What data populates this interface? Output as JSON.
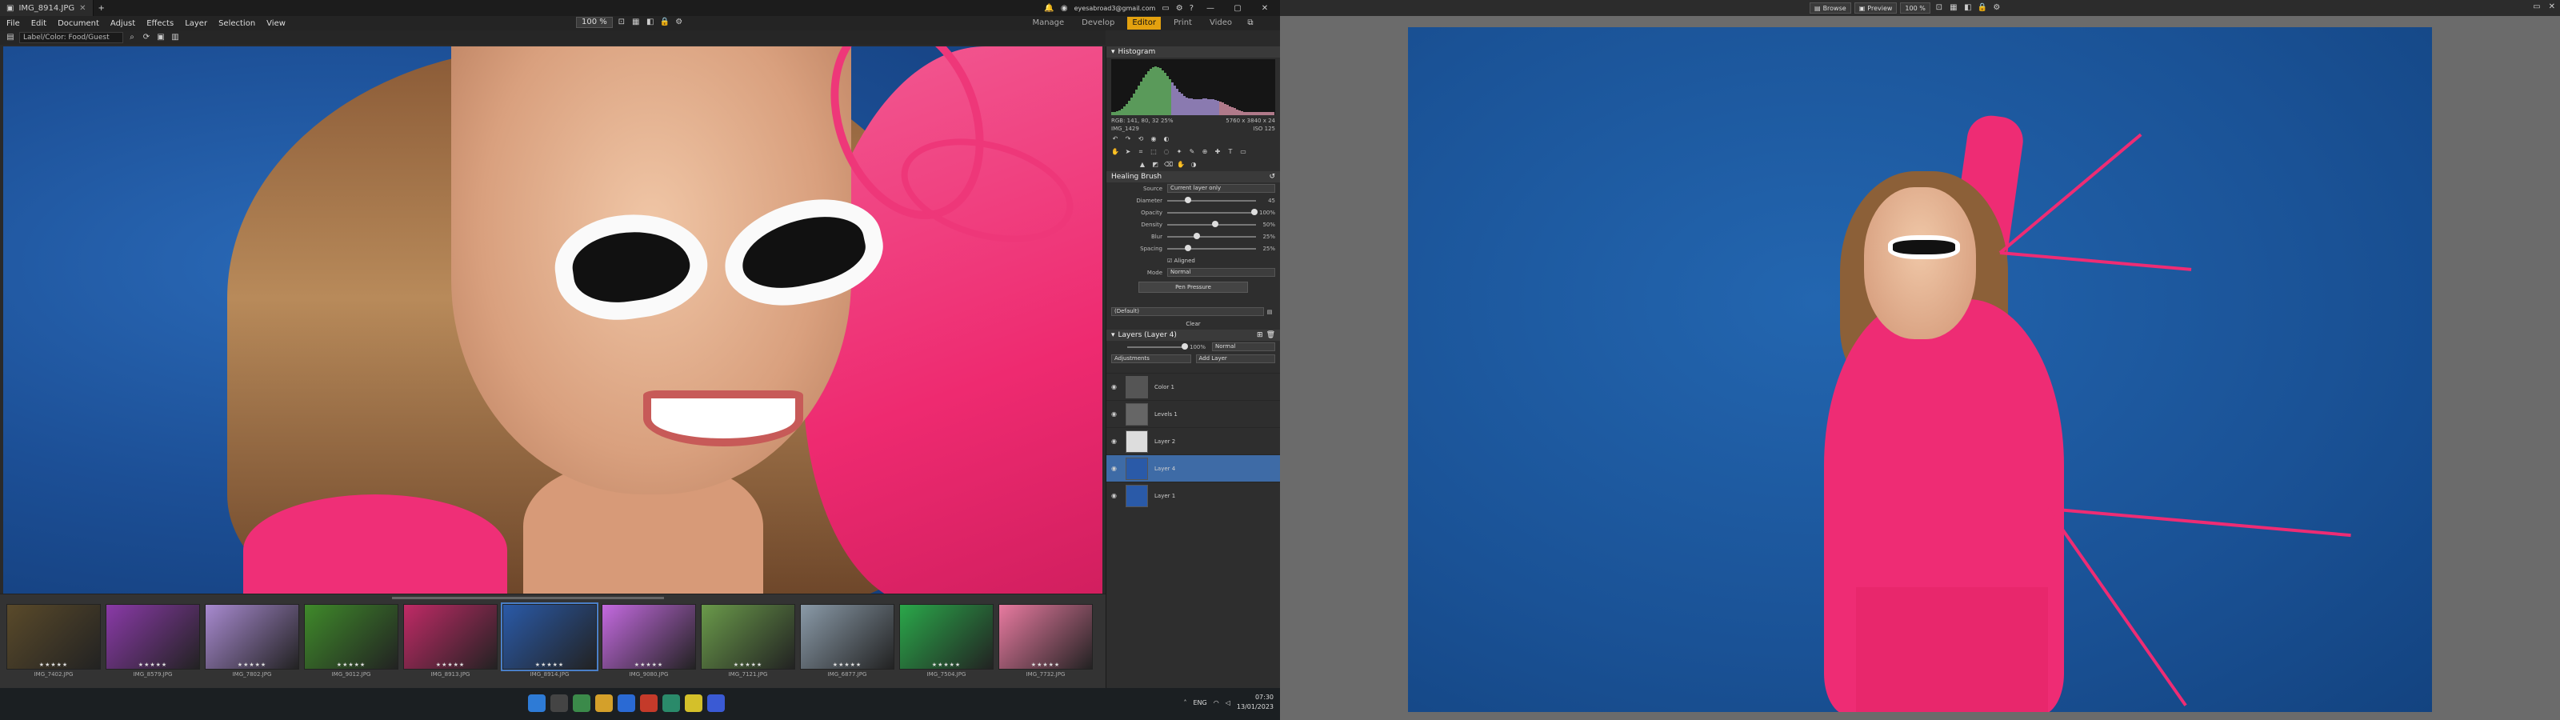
{
  "app": {
    "tab_title": "IMG_8914.JPG",
    "account": "eyesabroad3@gmail.com",
    "menu": [
      "File",
      "Edit",
      "Document",
      "Adjust",
      "Effects",
      "Layer",
      "Selection",
      "View"
    ],
    "modes": [
      "Manage",
      "Develop",
      "Editor",
      "Print",
      "Video"
    ],
    "active_mode": "Editor",
    "zoom": "100 %"
  },
  "path": {
    "value": "Label/Color: Food/Guest"
  },
  "panel": {
    "histogram_title": "Histogram",
    "histogram_info": "RGB: 141, 80, 32 25%",
    "file_info": "IMG_1429",
    "file_dims": "5760 x 3840 x 24",
    "iso_info": "ISO 125",
    "tool_title": "Healing Brush",
    "source_label": "Source",
    "source_value": "Current layer only",
    "params": [
      {
        "label": "Diameter",
        "value": "45"
      },
      {
        "label": "Opacity",
        "value": "100%"
      },
      {
        "label": "Density",
        "value": "50%"
      },
      {
        "label": "Blur",
        "value": "25%"
      },
      {
        "label": "Spacing",
        "value": "25%"
      }
    ],
    "aligned_label": "Aligned",
    "mode_label": "Mode",
    "mode_value": "Normal",
    "preview_button": "Pen Pressure",
    "preset_value": "(Default)",
    "clear_button": "Clear",
    "layers_title": "Layers (Layer 4)",
    "layer_opacity": "100%",
    "layer_blend": "Normal",
    "adjustments_button": "Adjustments",
    "add_layer_button": "Add Layer",
    "layers": [
      {
        "name": "Color 1",
        "selected": false
      },
      {
        "name": "Levels 1",
        "selected": false
      },
      {
        "name": "Layer 2",
        "selected": false
      },
      {
        "name": "Layer 4",
        "selected": true
      },
      {
        "name": "Layer 1",
        "selected": false
      }
    ]
  },
  "filmstrip": {
    "thumbs": [
      {
        "name": "IMG_7402.JPG",
        "color": "#5a4a2a",
        "selected": false
      },
      {
        "name": "IMG_8579.JPG",
        "color": "#8a3aa8",
        "selected": false
      },
      {
        "name": "IMG_7802.JPG",
        "color": "#a88ad0",
        "selected": false
      },
      {
        "name": "IMG_9012.JPG",
        "color": "#3f8a2a",
        "selected": false
      },
      {
        "name": "IMG_8913.JPG",
        "color": "#c02a66",
        "selected": false
      },
      {
        "name": "IMG_8914.JPG",
        "color": "#2a5aa8",
        "selected": true
      },
      {
        "name": "IMG_9080.JPG",
        "color": "#c46ae0",
        "selected": false
      },
      {
        "name": "IMG_7121.JPG",
        "color": "#6a9a4a",
        "selected": false
      },
      {
        "name": "IMG_6877.JPG",
        "color": "#8a9aa8",
        "selected": false
      },
      {
        "name": "IMG_7504.JPG",
        "color": "#2aa84a",
        "selected": false
      },
      {
        "name": "IMG_7732.JPG",
        "color": "#e87aa0",
        "selected": false
      }
    ]
  },
  "taskbar": {
    "lang": "ENG",
    "time": "07:30",
    "date": "13/01/2023"
  },
  "viewer": {
    "browse_label": "Browse",
    "preview_label": "Preview",
    "zoom": "100 %"
  }
}
